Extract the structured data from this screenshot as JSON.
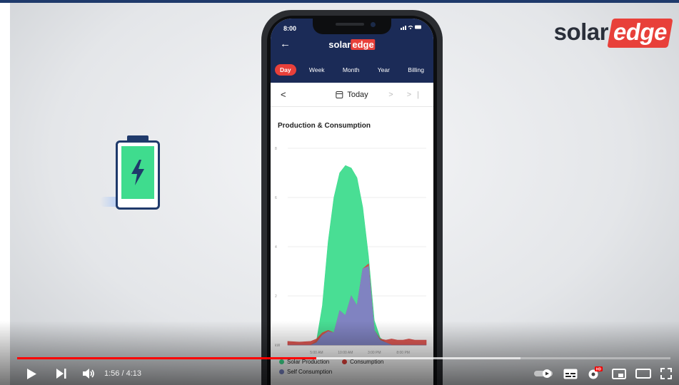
{
  "brand": {
    "logo_left": "solar",
    "logo_right": "edge"
  },
  "phone": {
    "status_time": "8:00",
    "status_icons": "‥‥‥ ● ▬",
    "app_logo_left": "solar",
    "app_logo_right": "edge",
    "tabs": [
      {
        "label": "Day",
        "active": true
      },
      {
        "label": "Week",
        "active": false
      },
      {
        "label": "Month",
        "active": false
      },
      {
        "label": "Year",
        "active": false
      },
      {
        "label": "Billing",
        "active": false
      }
    ],
    "date_label": "Today",
    "date_prev": "<",
    "date_next": "> >|",
    "chart_title": "Production & Consumption"
  },
  "chart_data": {
    "type": "area",
    "title": "Production & Consumption",
    "y_ticks": [
      "8",
      "6",
      "4",
      "2",
      "kW"
    ],
    "x_ticks": [
      "5:00 AM",
      "10:00 AM",
      "3:00 PM",
      "8:00 PM"
    ],
    "ylim": [
      0,
      8
    ],
    "x": [
      0,
      2,
      4,
      5,
      6,
      7,
      8,
      9,
      10,
      11,
      12,
      13,
      14,
      15,
      16,
      17,
      18,
      19,
      20,
      21,
      22,
      24
    ],
    "series": [
      {
        "name": "Solar Production",
        "color": "#3fdc8e",
        "values": [
          0,
          0,
          0,
          0.2,
          1.6,
          4.2,
          6.0,
          7.0,
          7.3,
          7.2,
          6.8,
          5.6,
          3.6,
          1.0,
          0.3,
          0.1,
          0,
          0,
          0,
          0,
          0,
          0
        ]
      },
      {
        "name": "Consumption",
        "color": "#e0403a",
        "values": [
          0.15,
          0.12,
          0.15,
          0.25,
          0.5,
          0.6,
          0.5,
          1.4,
          1.2,
          2.0,
          1.6,
          3.1,
          3.3,
          0.6,
          0.25,
          0.2,
          0.25,
          0.2,
          0.2,
          0.25,
          0.2,
          0.2
        ]
      },
      {
        "name": "Self Consumption",
        "color": "#7b86c8",
        "values": [
          0,
          0,
          0,
          0.1,
          0.4,
          0.55,
          0.5,
          1.4,
          1.2,
          2.0,
          1.6,
          3.1,
          3.2,
          0.6,
          0.2,
          0.1,
          0,
          0,
          0,
          0,
          0,
          0
        ]
      }
    ],
    "grid": true,
    "legend_position": "bottom"
  },
  "player": {
    "time": "1:56 / 4:13",
    "played_fraction": 0.458,
    "loaded_fraction": 0.77
  },
  "colors": {
    "accent": "#e8403a",
    "navy": "#1b2b57",
    "progress": "#ff0000"
  }
}
